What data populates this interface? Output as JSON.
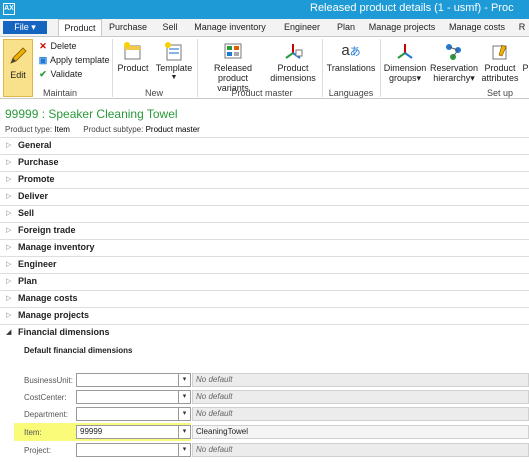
{
  "window": {
    "title": "Released product details (1 - usmf) - Proc"
  },
  "tabs": [
    "File ▾",
    "Product",
    "Purchase",
    "Sell",
    "Manage inventory",
    "Engineer",
    "Plan",
    "Manage projects",
    "Manage costs",
    "R"
  ],
  "ribbon": {
    "maintain": {
      "edit": "Edit",
      "delete": "Delete",
      "apply_template": "Apply template",
      "validate": "Validate",
      "group": "Maintain"
    },
    "new": {
      "product": "Product",
      "template": "Template",
      "group": "New"
    },
    "product_master": {
      "variants": [
        "Released product",
        "variants"
      ],
      "dimensions": [
        "Product",
        "dimensions"
      ],
      "group": "Product master"
    },
    "languages": {
      "translations": "Translations",
      "group": "Languages"
    },
    "setup": {
      "dimension_groups": [
        "Dimension",
        "groups▾"
      ],
      "reservation": [
        "Reservation",
        "hierarchy▾"
      ],
      "attributes": [
        "Product",
        "attributes"
      ],
      "p": "P",
      "group": "Set up"
    }
  },
  "header": {
    "title": "99999 : Speaker Cleaning Towel",
    "type_label": "Product type:",
    "type_value": "Item",
    "subtype_label": "Product subtype:",
    "subtype_value": "Product master"
  },
  "fasttabs": [
    "General",
    "Purchase",
    "Promote",
    "Deliver",
    "Sell",
    "Foreign trade",
    "Manage inventory",
    "Engineer",
    "Plan",
    "Manage costs",
    "Manage projects",
    "Financial dimensions"
  ],
  "financial": {
    "subtitle": "Default financial dimensions",
    "rows": [
      {
        "label": "BusinessUnit:",
        "value": "",
        "desc": "No default"
      },
      {
        "label": "CostCenter:",
        "value": "",
        "desc": "No default"
      },
      {
        "label": "Department:",
        "value": "",
        "desc": "No default"
      },
      {
        "label": "Item:",
        "value": "99999",
        "desc": "CleaningTowel"
      },
      {
        "label": "Project:",
        "value": "",
        "desc": "No default"
      }
    ]
  },
  "colors": {
    "accent": "#1e9ad6",
    "title_green": "#2a9a3a",
    "highlight": "#fbfb7a"
  }
}
